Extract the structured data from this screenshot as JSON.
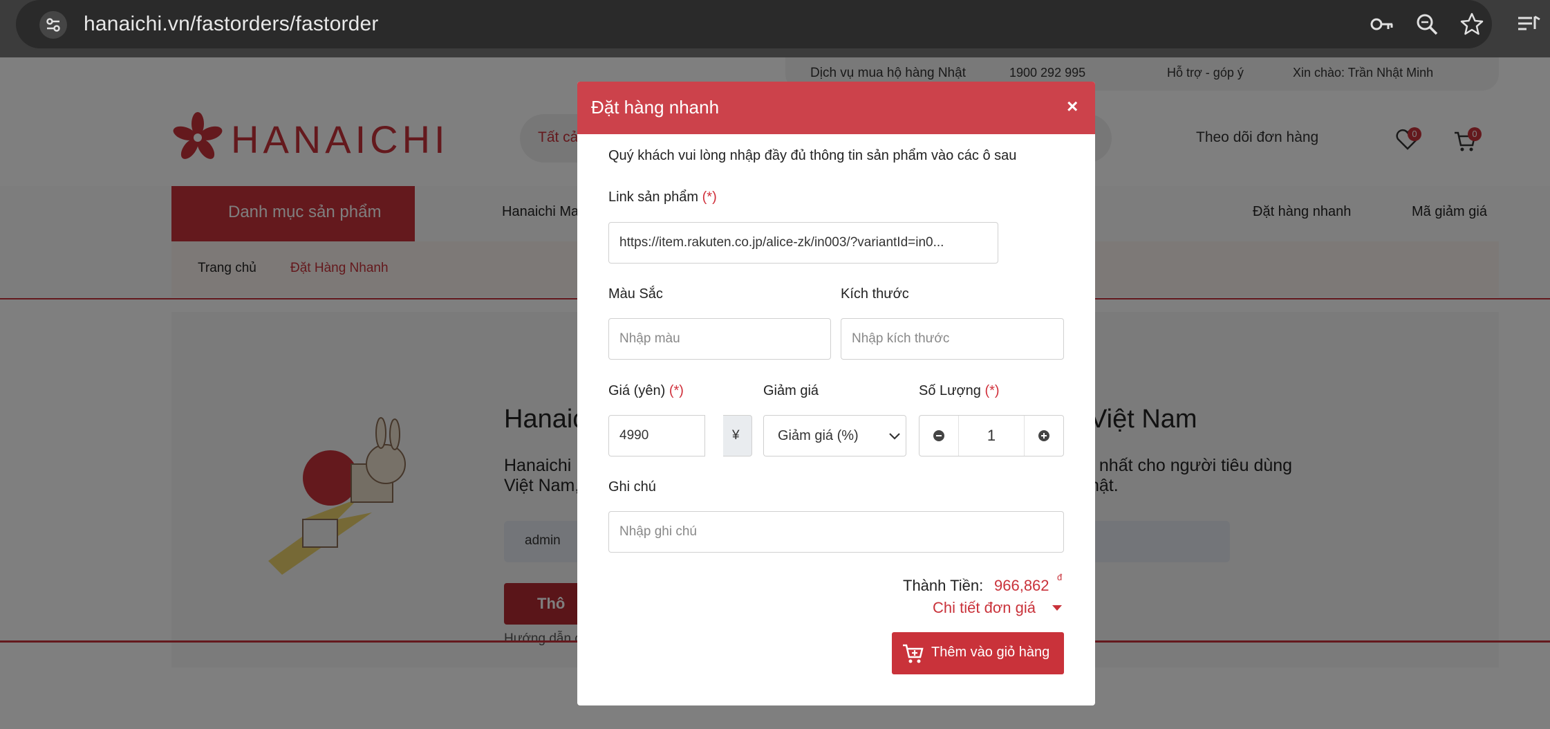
{
  "browser": {
    "url": "hanaichi.vn/fastorders/fastorder",
    "icons": [
      "tune-icon",
      "key-icon",
      "zoom-icon",
      "star-icon",
      "reading-list-icon"
    ]
  },
  "site": {
    "topbar": {
      "service": "Dịch vụ mua hộ hàng Nhật",
      "phone": "1900 292 995",
      "support": "Hỗ trợ - góp ý",
      "greeting": "Xin chào: Trần Nhật Minh"
    },
    "logo_text": "HANAICHI",
    "search_category": "Tất cả",
    "track_orders": "Theo dõi đơn hàng",
    "wishlist_count": "0",
    "cart_count": "0",
    "menu_label": "Danh mục sản phẩm",
    "nav_brand": "Hanaichi Ma",
    "nav_fast_order": "Đặt hàng nhanh",
    "nav_coupon": "Mã giảm giá",
    "breadcrumb_home": "Trang chủ",
    "breadcrumb_current": "Đặt Hàng Nhanh",
    "hero_title_left": "Hanaic",
    "hero_title_right": "Việt Nam",
    "hero_sub_left_1": "Hanaichi",
    "hero_sub_left_2": "Việt Nam,",
    "hero_sub_right_1": "í nhất cho người tiêu dùng",
    "hero_sub_right_2": "hật.",
    "admin_value": "admin",
    "hero_button": "Thô",
    "hero_hint": "Hướng dẫn c"
  },
  "modal": {
    "title": "Đặt hàng nhanh",
    "close": "×",
    "intro": "Quý khách vui lòng nhập đầy đủ thông tin sản phẩm vào các ô sau",
    "required_mark": "(*)",
    "link_label": "Link sản phẩm",
    "link_value": "https://item.rakuten.co.jp/alice-zk/in003/?variantId=in0...",
    "color_label": "Màu Sắc",
    "color_placeholder": "Nhập màu",
    "size_label": "Kích thước",
    "size_placeholder": "Nhập kích thước",
    "price_label": "Giá (yên)",
    "price_value": "4990",
    "currency_symbol": "¥",
    "discount_label": "Giảm giá",
    "discount_select": "Giảm giá (%)",
    "qty_label": "Số Lượng",
    "qty_value": "1",
    "note_label": "Ghi chú",
    "note_placeholder": "Nhập ghi chú",
    "total_label": "Thành Tiền:",
    "total_value": "966,862",
    "total_currency": "đ",
    "detail_link": "Chi tiết đơn giá",
    "add_to_cart": "Thêm vào giỏ hàng"
  },
  "colors": {
    "brand_red": "#c9323a",
    "modal_header": "#cc424b",
    "overlay": "rgba(0,0,0,0.5)"
  }
}
